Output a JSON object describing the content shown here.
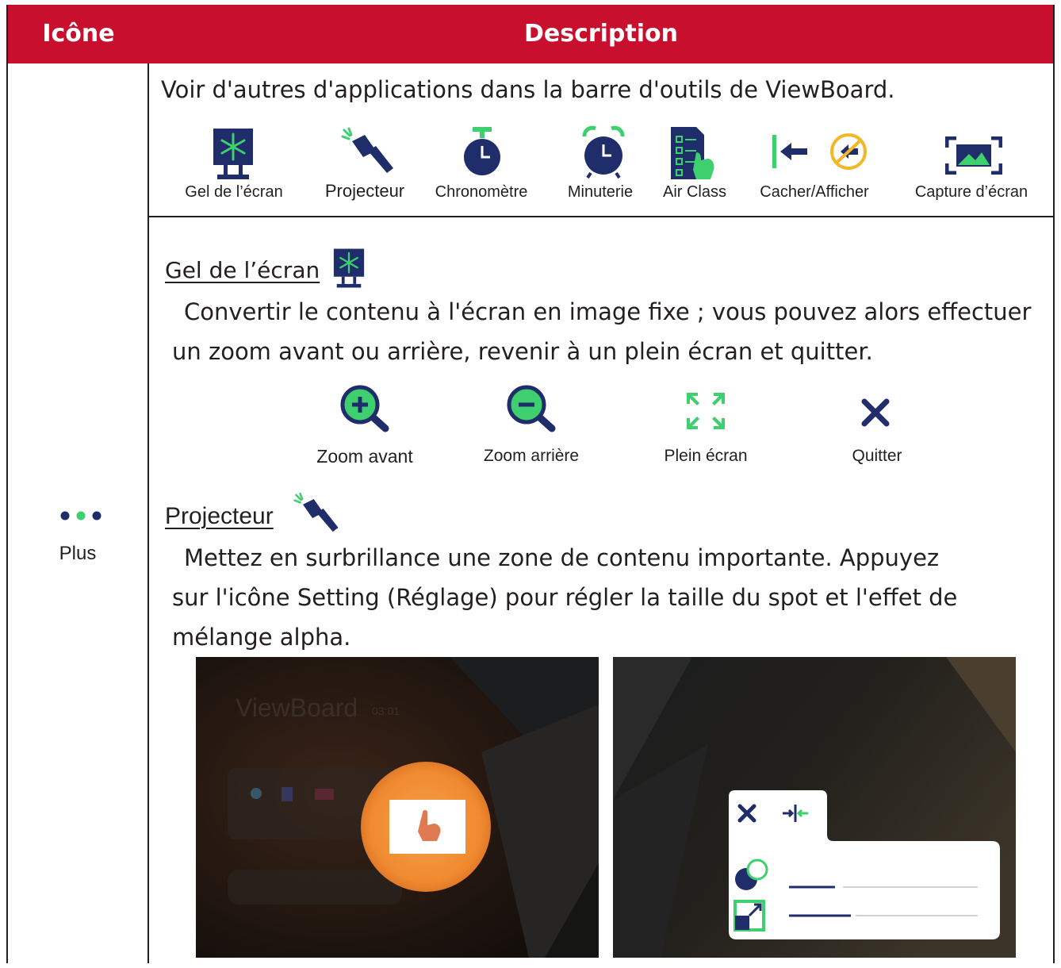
{
  "header": {
    "col_icon": "Icône",
    "col_description": "Description"
  },
  "left": {
    "icon": "more-dots-icon",
    "label": "Plus"
  },
  "toolbar": {
    "intro": "Voir d'autres d'applications dans la barre d'outils de ViewBoard.",
    "items": [
      {
        "label": "Gel de l’écran",
        "icon": "screen-freeze-icon"
      },
      {
        "label": "Projecteur",
        "icon": "spotlight-icon"
      },
      {
        "label": "Chronomètre",
        "icon": "stopwatch-icon"
      },
      {
        "label": "Minuterie",
        "icon": "timer-icon"
      },
      {
        "label": "Air Class",
        "icon": "air-class-icon"
      },
      {
        "label": "Cacher/Afficher",
        "icon": "hide-show-icon"
      },
      {
        "label": "Capture d’écran",
        "icon": "screen-capture-icon"
      }
    ]
  },
  "freeze": {
    "title": "Gel de l’écran",
    "line1": "Convertir le contenu à l'écran en image fixe ; vous pouvez alors effectuer",
    "line2": "un zoom avant ou arrière, revenir à un plein écran et quitter.",
    "actions": [
      {
        "label": "Zoom avant",
        "icon": "zoom-in-icon"
      },
      {
        "label": "Zoom arrière",
        "icon": "zoom-out-icon"
      },
      {
        "label": "Plein écran",
        "icon": "fullscreen-icon"
      },
      {
        "label": "Quitter",
        "icon": "close-icon"
      }
    ]
  },
  "spotlight": {
    "title": "Projecteur",
    "line1": "Mettez en surbrillance une zone de contenu importante. Appuyez",
    "line2": "sur l'icône Setting (Réglage) pour régler la taille du spot et l'effet de",
    "line3": "mélange alpha.",
    "screenshot1": {
      "brand": "ViewBoard",
      "time": "03:01"
    }
  },
  "colors": {
    "header_red": "#c8102e",
    "navy": "#1f2d6b",
    "green": "#3ecf6e"
  }
}
